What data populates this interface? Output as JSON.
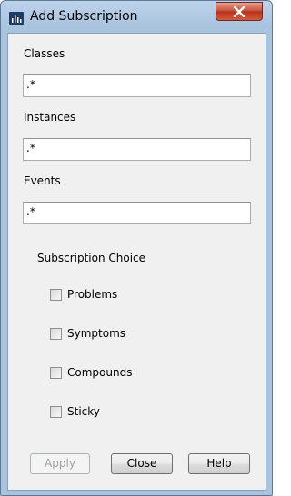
{
  "window": {
    "title": "Add Subscription",
    "icon": "bar-chart-icon",
    "close_icon": "close-x-icon"
  },
  "filters": {
    "classes_label": "Classes",
    "classes_value": ".*",
    "instances_label": "Instances",
    "instances_value": ".*",
    "events_label": "Events",
    "events_value": ".*"
  },
  "subscription": {
    "title": "Subscription Choice",
    "options": [
      {
        "label": "Problems",
        "checked": false
      },
      {
        "label": "Symptoms",
        "checked": false
      },
      {
        "label": "Compounds",
        "checked": false
      },
      {
        "label": "Sticky",
        "checked": false
      }
    ]
  },
  "buttons": {
    "apply": "Apply",
    "close": "Close",
    "help": "Help"
  },
  "colors": {
    "close_button": "#c8492f",
    "icon": "#1d3b64"
  }
}
